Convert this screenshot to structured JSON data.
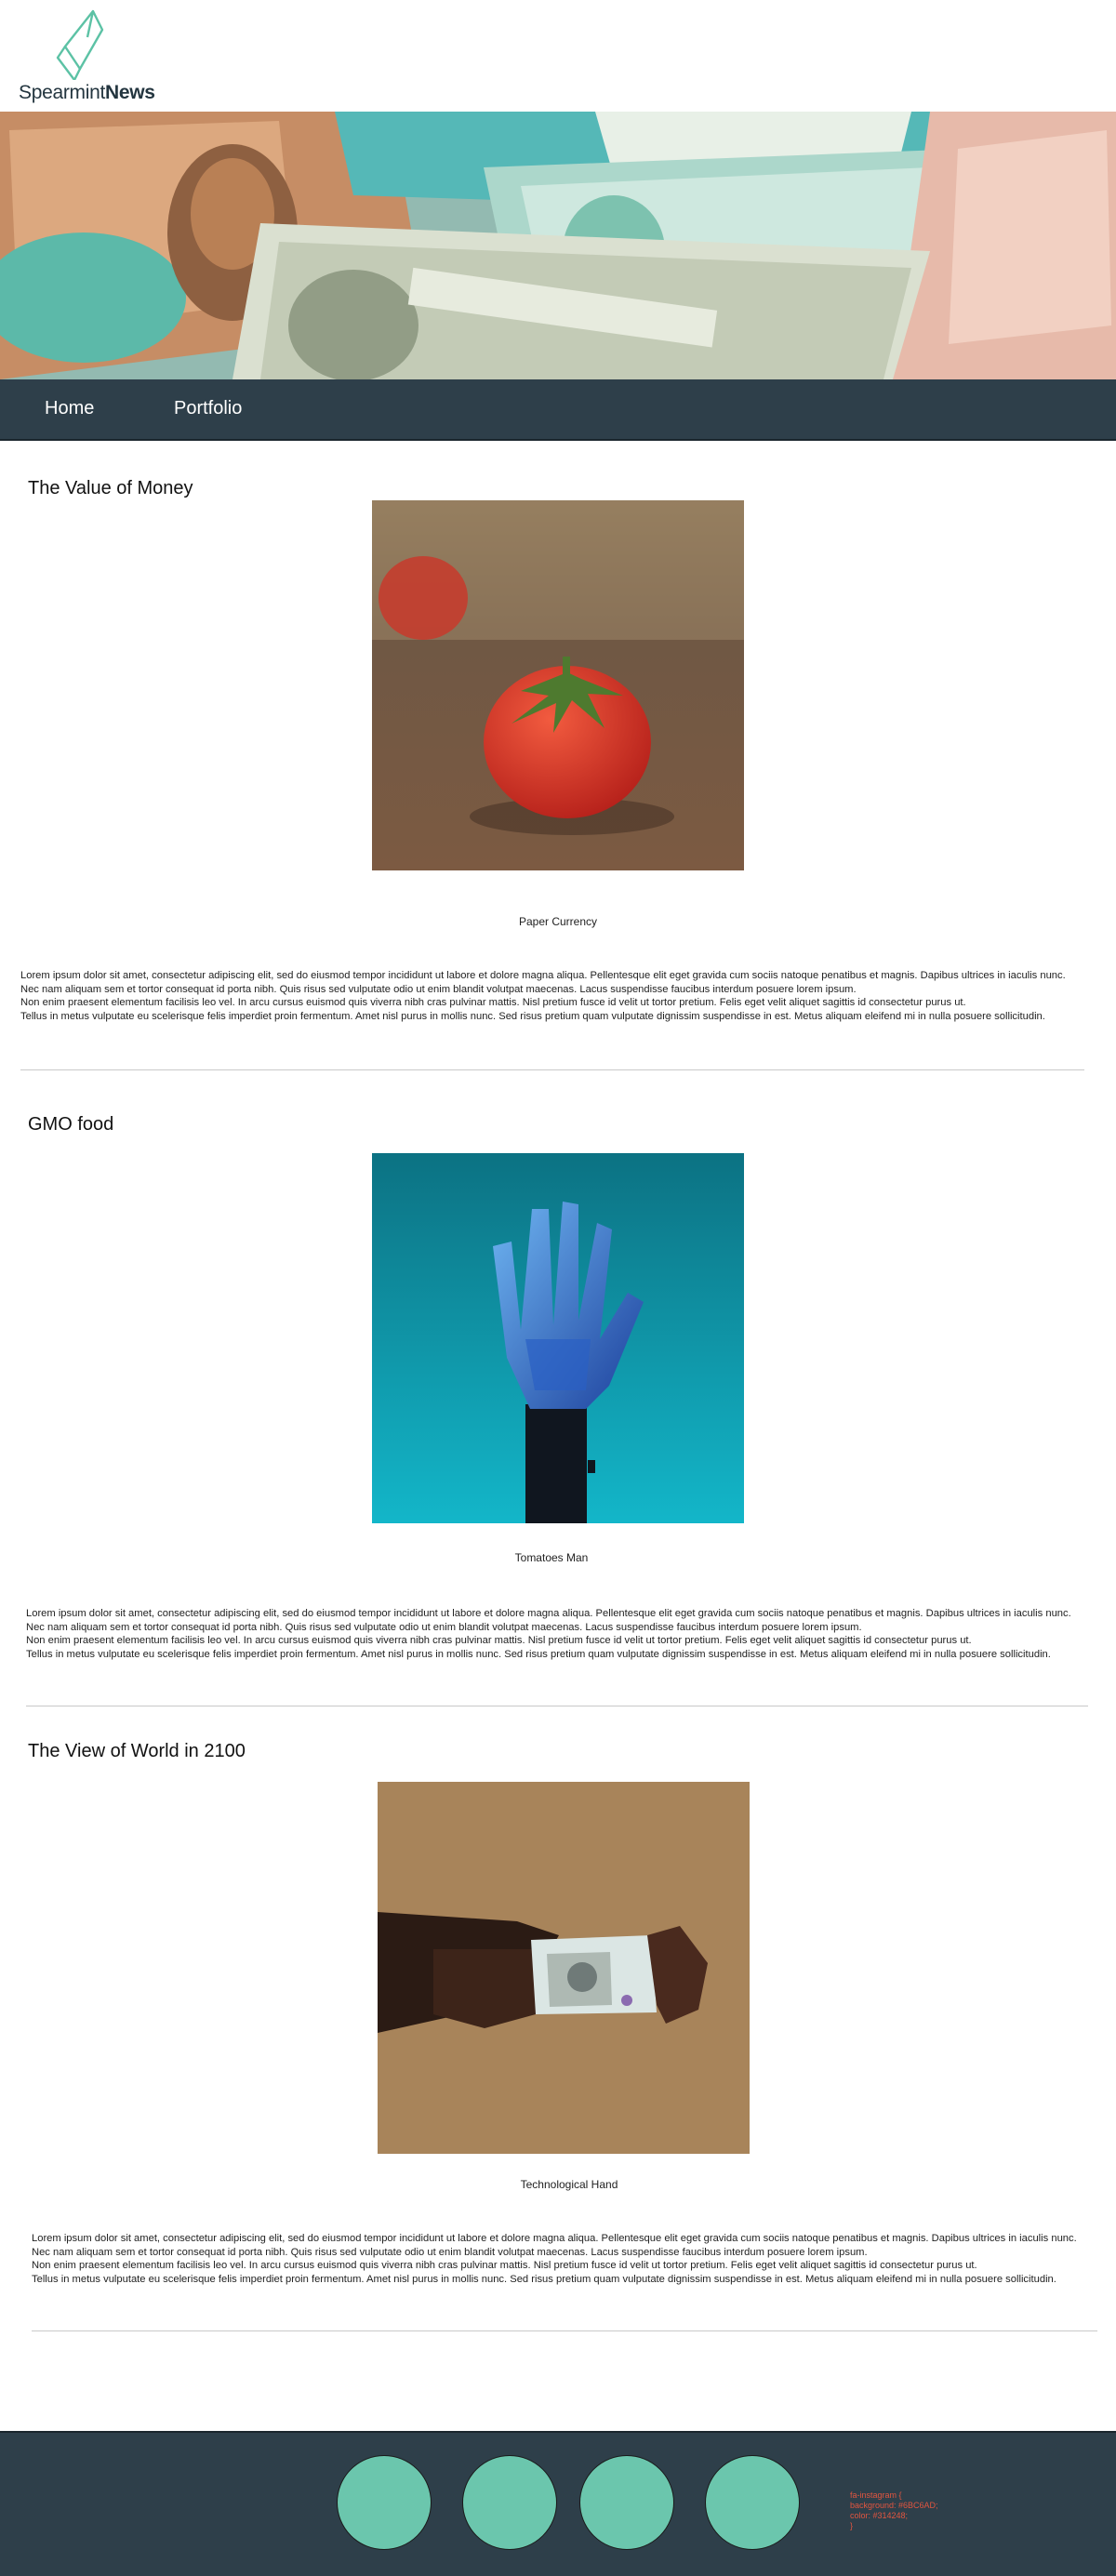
{
  "header": {
    "logo_text_light": "Spearmint",
    "logo_text_bold": "News"
  },
  "nav": {
    "items": [
      {
        "label": "Home"
      },
      {
        "label": "Portfolio"
      }
    ]
  },
  "articles": [
    {
      "title": "The Value of Money",
      "caption": "Paper Currency",
      "paragraph": [
        "Lorem ipsum dolor sit amet, consectetur adipiscing elit, sed do eiusmod tempor incididunt ut labore et dolore magna aliqua. Pellentesque elit eget gravida cum sociis natoque penatibus et magnis.  Dapibus ultrices in iaculis nunc.",
        "Nec nam aliquam sem et tortor consequat id porta nibh. Quis risus sed vulputate odio ut enim blandit volutpat maecenas. Lacus suspendisse faucibus interdum posuere lorem ipsum.",
        "Non enim praesent elementum facilisis leo vel. In arcu cursus euismod quis viverra nibh cras pulvinar mattis. Nisl pretium fusce id velit ut tortor pretium.  Felis eget velit aliquet sagittis id consectetur purus ut.",
        "Tellus in metus vulputate eu scelerisque felis imperdiet proin fermentum. Amet nisl purus in mollis nunc. Sed risus pretium quam vulputate dignissim suspendisse in est.  Metus aliquam eleifend mi in nulla posuere sollicitudin."
      ]
    },
    {
      "title": "GMO food",
      "caption": "Tomatoes Man",
      "paragraph": [
        "Lorem ipsum dolor sit amet, consectetur adipiscing elit, sed do eiusmod tempor incididunt ut labore et dolore magna aliqua. Pellentesque elit eget gravida cum sociis natoque penatibus et magnis.  Dapibus ultrices in iaculis nunc.",
        "Nec nam aliquam sem et tortor consequat id porta nibh. Quis risus sed vulputate odio ut enim blandit volutpat maecenas. Lacus suspendisse faucibus interdum posuere lorem ipsum.",
        "Non enim praesent elementum facilisis leo vel. In arcu cursus euismod quis viverra nibh cras pulvinar mattis. Nisl pretium fusce id velit ut tortor pretium.  Felis eget velit aliquet sagittis id consectetur purus ut.",
        "Tellus in metus vulputate eu scelerisque felis imperdiet proin fermentum. Amet nisl purus in mollis nunc. Sed risus pretium quam vulputate dignissim suspendisse in est.  Metus aliquam eleifend mi in nulla posuere sollicitudin."
      ]
    },
    {
      "title": "The View of World in 2100",
      "caption": "Technological Hand",
      "paragraph": [
        "Lorem ipsum dolor sit amet, consectetur adipiscing elit, sed do eiusmod tempor incididunt ut labore et dolore magna aliqua. Pellentesque elit eget gravida cum sociis natoque penatibus et magnis.  Dapibus ultrices in iaculis nunc.",
        "Nec nam aliquam sem et tortor consequat id porta nibh. Quis risus sed vulputate odio ut enim blandit volutpat maecenas. Lacus suspendisse faucibus interdum posuere lorem ipsum.",
        "Non enim praesent elementum facilisis leo vel. In arcu cursus euismod quis viverra nibh cras pulvinar mattis. Nisl pretium fusce id velit ut tortor pretium.  Felis eget velit aliquet sagittis id consectetur purus ut.",
        "Tellus in metus vulputate eu scelerisque felis imperdiet proin fermentum. Amet nisl purus in mollis nunc. Sed risus pretium quam vulputate dignissim suspendisse in est.  Metus aliquam eleifend mi in nulla posuere sollicitudin."
      ]
    }
  ],
  "footer": {
    "social_icon_count": 4,
    "note_lines": [
      "fa-instagram {",
      "  background: #6BC6AD;",
      "  color: #314248;",
      "}"
    ]
  },
  "colors": {
    "nav_bg": "#2e3f4a",
    "accent": "#6bc6ad",
    "footer_note": "#e2553f"
  }
}
